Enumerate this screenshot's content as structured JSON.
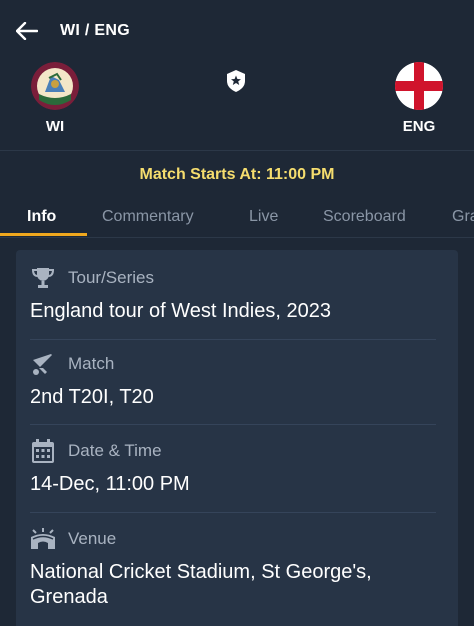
{
  "header": {
    "title": "WI / ENG"
  },
  "teams": {
    "home": {
      "abbr": "WI"
    },
    "away": {
      "abbr": "ENG"
    }
  },
  "match_start": "Match Starts At: 11:00 PM",
  "tabs": [
    {
      "label": "Info",
      "active": true
    },
    {
      "label": "Commentary"
    },
    {
      "label": "Live"
    },
    {
      "label": "Scoreboard"
    },
    {
      "label": "Gra"
    }
  ],
  "info": {
    "series": {
      "label": "Tour/Series",
      "value": "England tour of West Indies, 2023",
      "icon": "trophy-icon"
    },
    "match": {
      "label": "Match",
      "value": "2nd T20I, T20",
      "icon": "cricket-bat-icon"
    },
    "datetime": {
      "label": "Date & Time",
      "value": "14-Dec, 11:00 PM",
      "icon": "calendar-icon"
    },
    "venue": {
      "label": "Venue",
      "value_line1": "National Cricket Stadium, St George's,",
      "value_line2": "Grenada",
      "icon": "stadium-icon"
    }
  },
  "colors": {
    "accent": "#f0a81e",
    "highlight": "#f5dd6e",
    "background": "#1e2836",
    "card": "#273446"
  }
}
